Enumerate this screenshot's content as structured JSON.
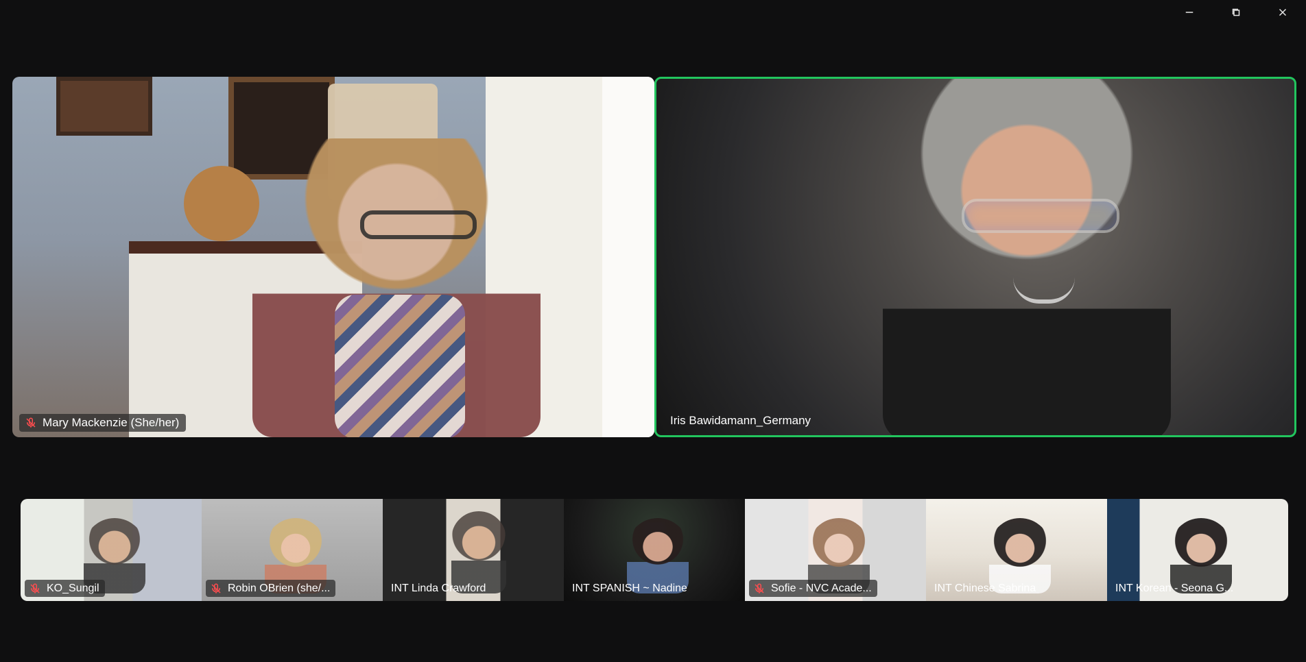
{
  "window": {
    "controls": {
      "minimize_icon": "minimize-icon",
      "restore_icon": "restore-icon",
      "close_icon": "close-icon"
    }
  },
  "meeting": {
    "accent_active_speaker": "#22c55e",
    "main_tiles": [
      {
        "name": "Mary Mackenzie (She/her)",
        "muted": true
      },
      {
        "name": "Iris Bawidamann_Germany",
        "muted": false,
        "active_speaker": true
      }
    ],
    "thumbnails": [
      {
        "name": "KO_Sungil",
        "muted": true
      },
      {
        "name": "Robin OBrien (she/...",
        "muted": true
      },
      {
        "name": "INT Linda Crawford",
        "muted": false
      },
      {
        "name": "INT SPANISH ~ Nadine",
        "muted": false
      },
      {
        "name": "Sofie - NVC Acade...",
        "muted": true
      },
      {
        "name": "INT Chinese Sabrina",
        "muted": false
      },
      {
        "name": "INT Korean - Seona G...",
        "muted": false
      }
    ]
  },
  "icons": {
    "mic_muted": "mic-muted-icon"
  }
}
